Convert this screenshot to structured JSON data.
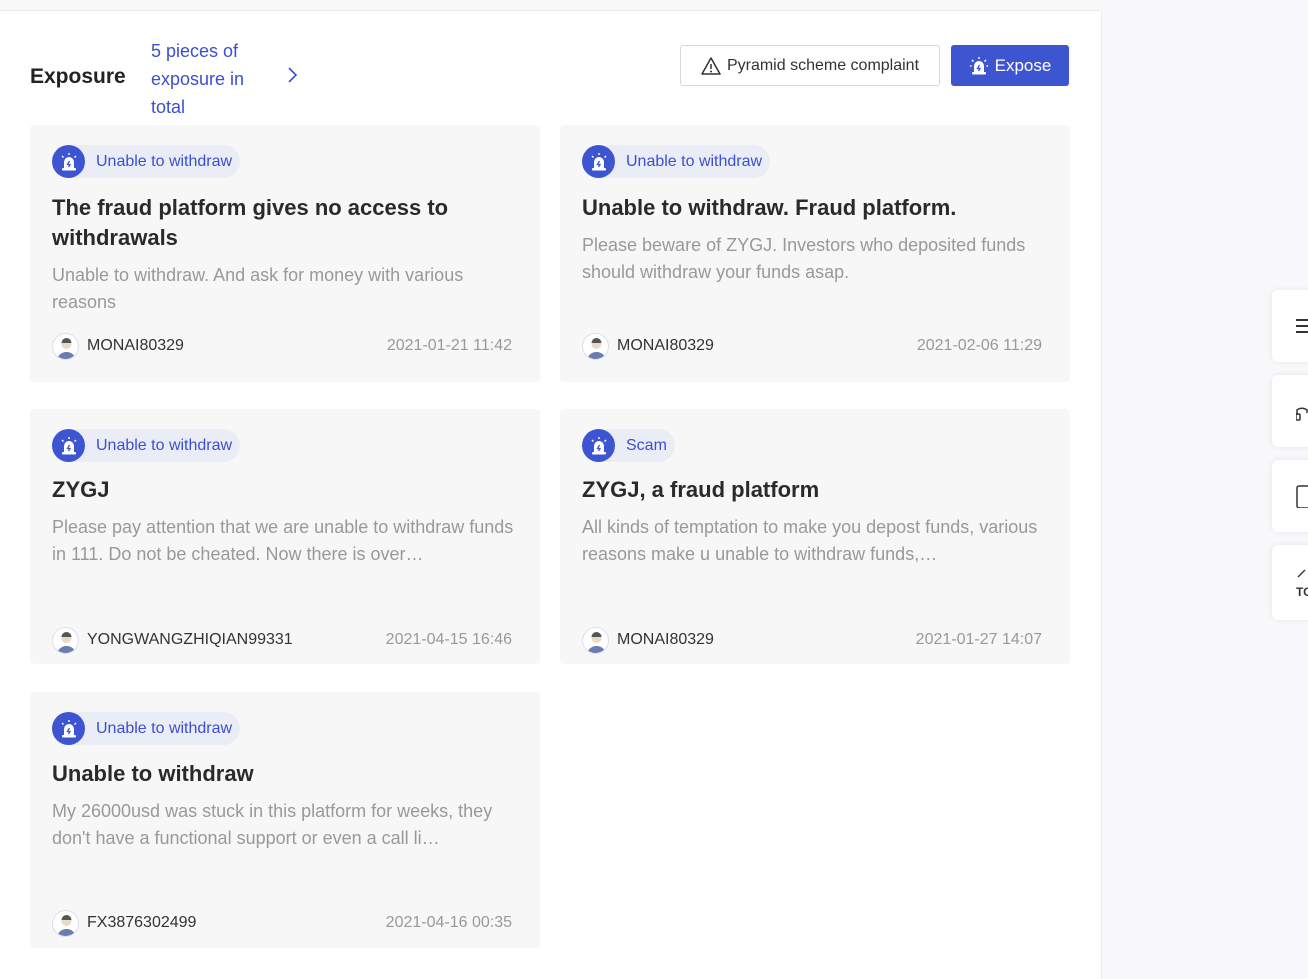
{
  "header": {
    "title": "Exposure",
    "count_link": "5 pieces of exposure in total",
    "complaint_label": "Pyramid scheme complaint",
    "expose_label": "Expose"
  },
  "cards": [
    {
      "tag": "Unable to withdraw",
      "title": "The fraud platform gives no access to withdrawals",
      "body": "Unable to withdraw. And ask for money with various reasons",
      "user": "MONAI80329",
      "date": "2021-01-21 11:42"
    },
    {
      "tag": "Unable to withdraw",
      "title": "Unable to withdraw. Fraud platform.",
      "body": "Please beware of ZYGJ. Investors who deposited funds should withdraw your funds asap.",
      "user": "MONAI80329",
      "date": "2021-02-06 11:29"
    },
    {
      "tag": "Unable to withdraw",
      "title": "ZYGJ",
      "body": "Please pay attention that we are unable to withdraw funds in 111. Do not be cheated. Now there is over…",
      "user": "YONGWANGZHIQIAN99331",
      "date": "2021-04-15 16:46"
    },
    {
      "tag": "Scam",
      "title": "ZYGJ, a fraud platform",
      "body": "All kinds of temptation to make you depost funds, various reasons make u unable to withdraw funds,…",
      "user": "MONAI80329",
      "date": "2021-01-27 14:07"
    },
    {
      "tag": "Unable to withdraw",
      "title": "Unable to withdraw",
      "body": "My 26000usd was stuck in this platform for weeks, they don't have a functional support or even a call li…",
      "user": "FX3876302499",
      "date": "2021-04-16 00:35"
    }
  ],
  "side": {
    "top_label": "TO"
  },
  "colors": {
    "accent": "#3e55d1",
    "tag_bg": "#ebedf6",
    "card_bg": "#f7f7f8"
  }
}
